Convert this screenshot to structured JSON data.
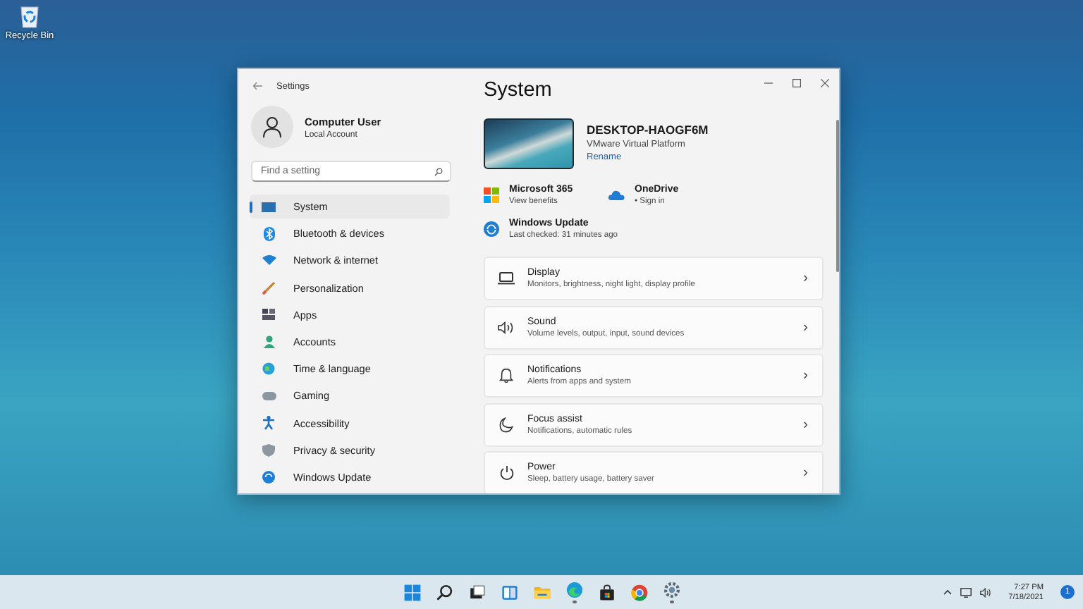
{
  "desktop": {
    "icons": [
      {
        "label": "Recycle Bin"
      }
    ]
  },
  "window": {
    "title": "Settings",
    "account": {
      "name": "Computer User",
      "type": "Local Account"
    },
    "search": {
      "placeholder": "Find a setting"
    },
    "nav": [
      {
        "label": "System",
        "selected": true
      },
      {
        "label": "Bluetooth & devices",
        "selected": false
      },
      {
        "label": "Network & internet",
        "selected": false
      },
      {
        "label": "Personalization",
        "selected": false
      },
      {
        "label": "Apps",
        "selected": false
      },
      {
        "label": "Accounts",
        "selected": false
      },
      {
        "label": "Time & language",
        "selected": false
      },
      {
        "label": "Gaming",
        "selected": false
      },
      {
        "label": "Accessibility",
        "selected": false
      },
      {
        "label": "Privacy & security",
        "selected": false
      },
      {
        "label": "Windows Update",
        "selected": false
      }
    ],
    "page_title": "System",
    "device": {
      "name": "DESKTOP-HAOGF6M",
      "model": "VMware Virtual Platform",
      "link": "Rename"
    },
    "quick_links": [
      {
        "title": "Microsoft 365",
        "subtitle": "View benefits"
      },
      {
        "title": "OneDrive",
        "subtitle": "• Sign in"
      }
    ],
    "update": {
      "title": "Windows Update",
      "subtitle": "Last checked: 31 minutes ago"
    },
    "settings": [
      {
        "title": "Display",
        "subtitle": "Monitors, brightness, night light, display profile",
        "chevron": "›"
      },
      {
        "title": "Sound",
        "subtitle": "Volume levels, output, input, sound devices",
        "chevron": "›"
      },
      {
        "title": "Notifications",
        "subtitle": "Alerts from apps and system",
        "chevron": "›"
      },
      {
        "title": "Focus assist",
        "subtitle": "Notifications, automatic rules",
        "chevron": "›"
      },
      {
        "title": "Power",
        "subtitle": "Sleep, battery usage, battery saver",
        "chevron": "›"
      }
    ]
  },
  "taskbar": {
    "apps": [
      {
        "running": false
      },
      {
        "running": false
      },
      {
        "running": false
      },
      {
        "running": false
      },
      {
        "running": false
      },
      {
        "running": true
      },
      {
        "running": false
      },
      {
        "running": false
      },
      {
        "running": true
      }
    ],
    "tray": {
      "time": "7:27 PM",
      "date": "7/18/2021",
      "badge": "1"
    }
  }
}
